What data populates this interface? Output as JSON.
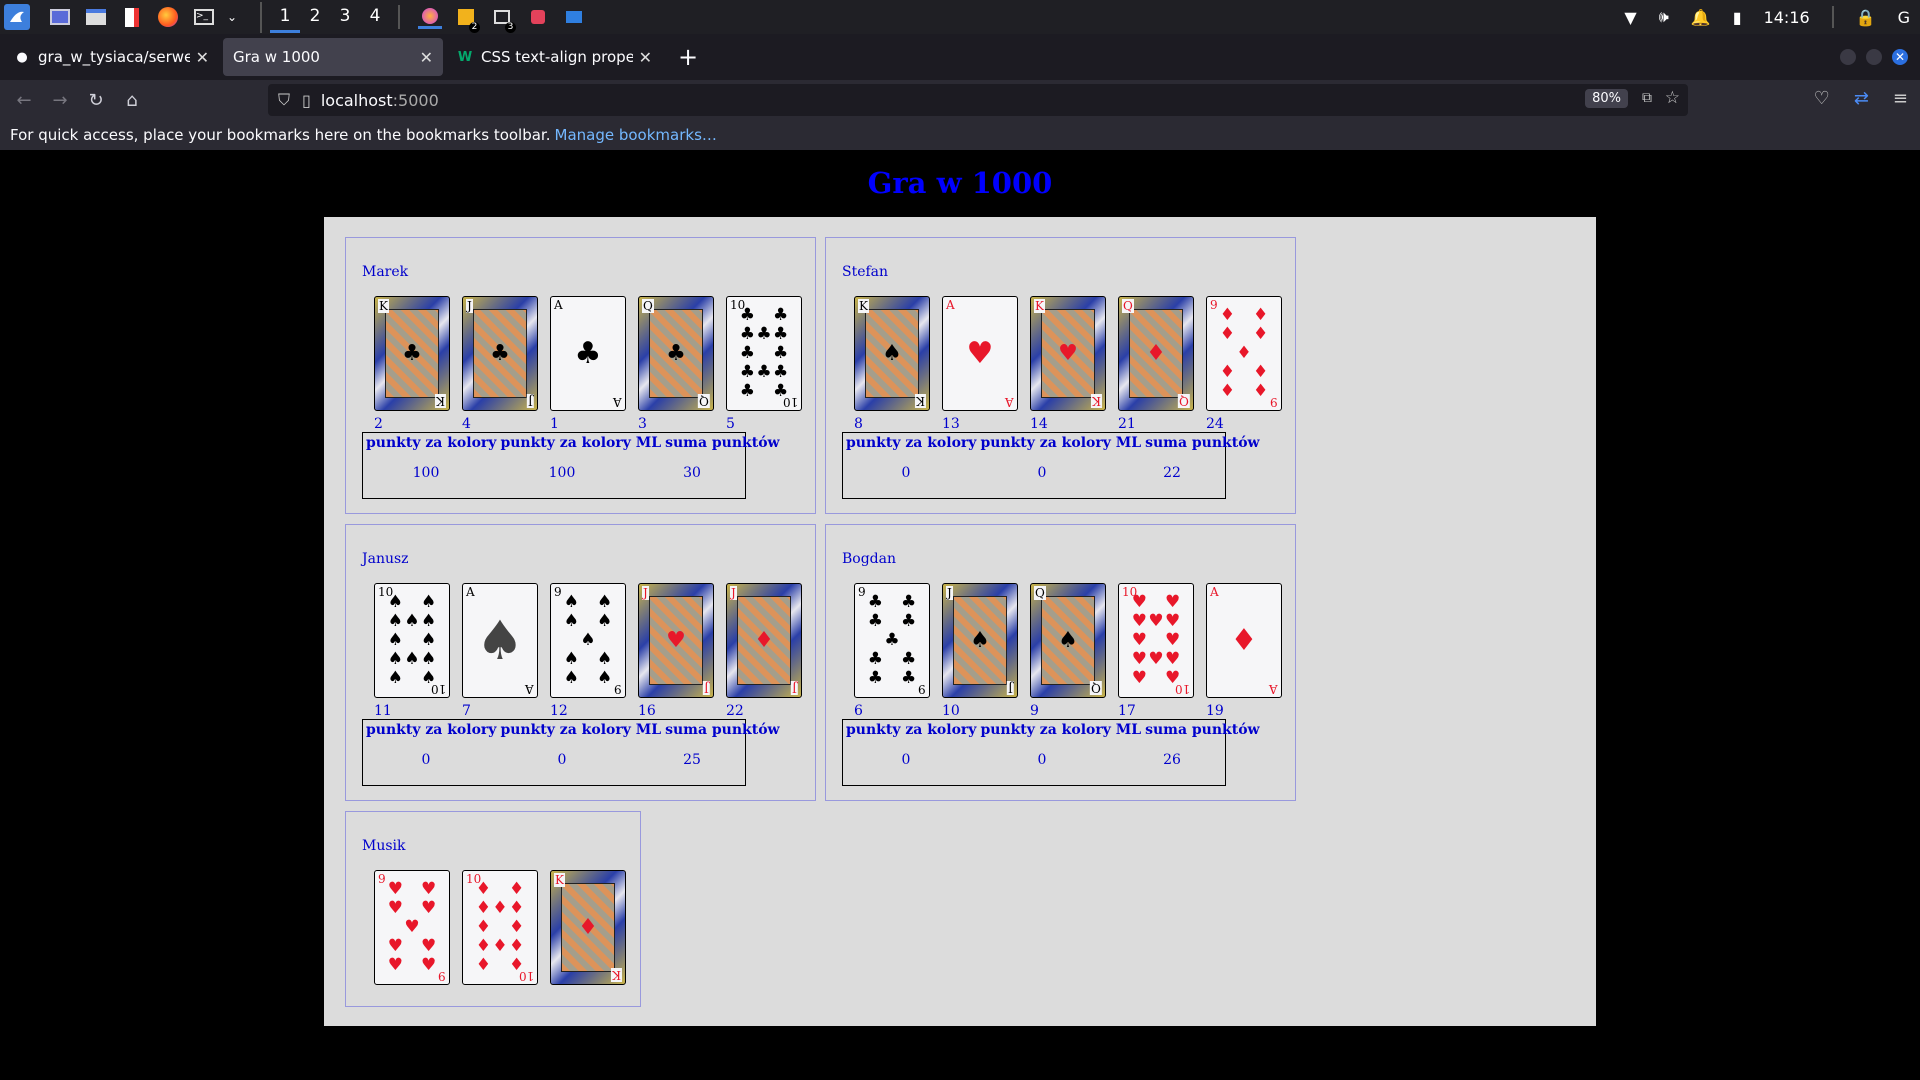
{
  "taskbar": {
    "workspaces": [
      "1",
      "2",
      "3",
      "4"
    ],
    "badge_a": "2",
    "badge_b": "3",
    "clock": "14:16"
  },
  "browser": {
    "tabs": [
      {
        "title": "gra_w_tysiaca/serwer.py",
        "active": false
      },
      {
        "title": "Gra w 1000",
        "active": true
      },
      {
        "title": "CSS text-align property",
        "active": false
      }
    ],
    "url_host": "localhost",
    "url_port": ":5000",
    "zoom": "80%",
    "bookmarks_text": "For quick access, place your bookmarks here on the bookmarks toolbar.",
    "bookmarks_link": "Manage bookmarks…"
  },
  "page": {
    "title": "Gra w 1000",
    "score_headers": [
      "punkty za kolory",
      "punkty za kolory ML",
      "suma punktów"
    ],
    "players": [
      {
        "name": "Marek",
        "cards": [
          {
            "rank": "K",
            "suit": "♣",
            "color": "black",
            "kind": "face",
            "index": "2"
          },
          {
            "rank": "J",
            "suit": "♣",
            "color": "black",
            "kind": "face",
            "index": "4"
          },
          {
            "rank": "A",
            "suit": "♣",
            "color": "black",
            "kind": "ace",
            "index": "1"
          },
          {
            "rank": "Q",
            "suit": "♣",
            "color": "black",
            "kind": "face",
            "index": "3"
          },
          {
            "rank": "10",
            "suit": "♣",
            "color": "black",
            "kind": "pips",
            "index": "5"
          }
        ],
        "scores": [
          "100",
          "100",
          "30"
        ]
      },
      {
        "name": "Stefan",
        "cards": [
          {
            "rank": "K",
            "suit": "♠",
            "color": "black",
            "kind": "face",
            "index": "8"
          },
          {
            "rank": "A",
            "suit": "♥",
            "color": "red",
            "kind": "ace",
            "index": "13"
          },
          {
            "rank": "K",
            "suit": "♥",
            "color": "red",
            "kind": "face",
            "index": "14"
          },
          {
            "rank": "Q",
            "suit": "♦",
            "color": "red",
            "kind": "face",
            "index": "21"
          },
          {
            "rank": "9",
            "suit": "♦",
            "color": "red",
            "kind": "pips",
            "index": "24"
          }
        ],
        "scores": [
          "0",
          "0",
          "22"
        ]
      },
      {
        "name": "Janusz",
        "cards": [
          {
            "rank": "10",
            "suit": "♠",
            "color": "black",
            "kind": "pips",
            "index": "11"
          },
          {
            "rank": "A",
            "suit": "♠",
            "color": "black",
            "kind": "ace-sp",
            "index": "7"
          },
          {
            "rank": "9",
            "suit": "♠",
            "color": "black",
            "kind": "pips",
            "index": "12"
          },
          {
            "rank": "J",
            "suit": "♥",
            "color": "red",
            "kind": "face",
            "index": "16"
          },
          {
            "rank": "J",
            "suit": "♦",
            "color": "red",
            "kind": "face",
            "index": "22"
          }
        ],
        "scores": [
          "0",
          "0",
          "25"
        ]
      },
      {
        "name": "Bogdan",
        "cards": [
          {
            "rank": "9",
            "suit": "♣",
            "color": "black",
            "kind": "pips",
            "index": "6"
          },
          {
            "rank": "J",
            "suit": "♠",
            "color": "black",
            "kind": "face",
            "index": "10"
          },
          {
            "rank": "Q",
            "suit": "♠",
            "color": "black",
            "kind": "face",
            "index": "9"
          },
          {
            "rank": "10",
            "suit": "♥",
            "color": "red",
            "kind": "pips",
            "index": "17"
          },
          {
            "rank": "A",
            "suit": "♦",
            "color": "red",
            "kind": "ace",
            "index": "19"
          }
        ],
        "scores": [
          "0",
          "0",
          "26"
        ]
      }
    ],
    "musik": {
      "name": "Musik",
      "cards": [
        {
          "rank": "9",
          "suit": "♥",
          "color": "red",
          "kind": "pips"
        },
        {
          "rank": "10",
          "suit": "♦",
          "color": "red",
          "kind": "pips"
        },
        {
          "rank": "K",
          "suit": "♦",
          "color": "red",
          "kind": "face"
        }
      ]
    }
  }
}
